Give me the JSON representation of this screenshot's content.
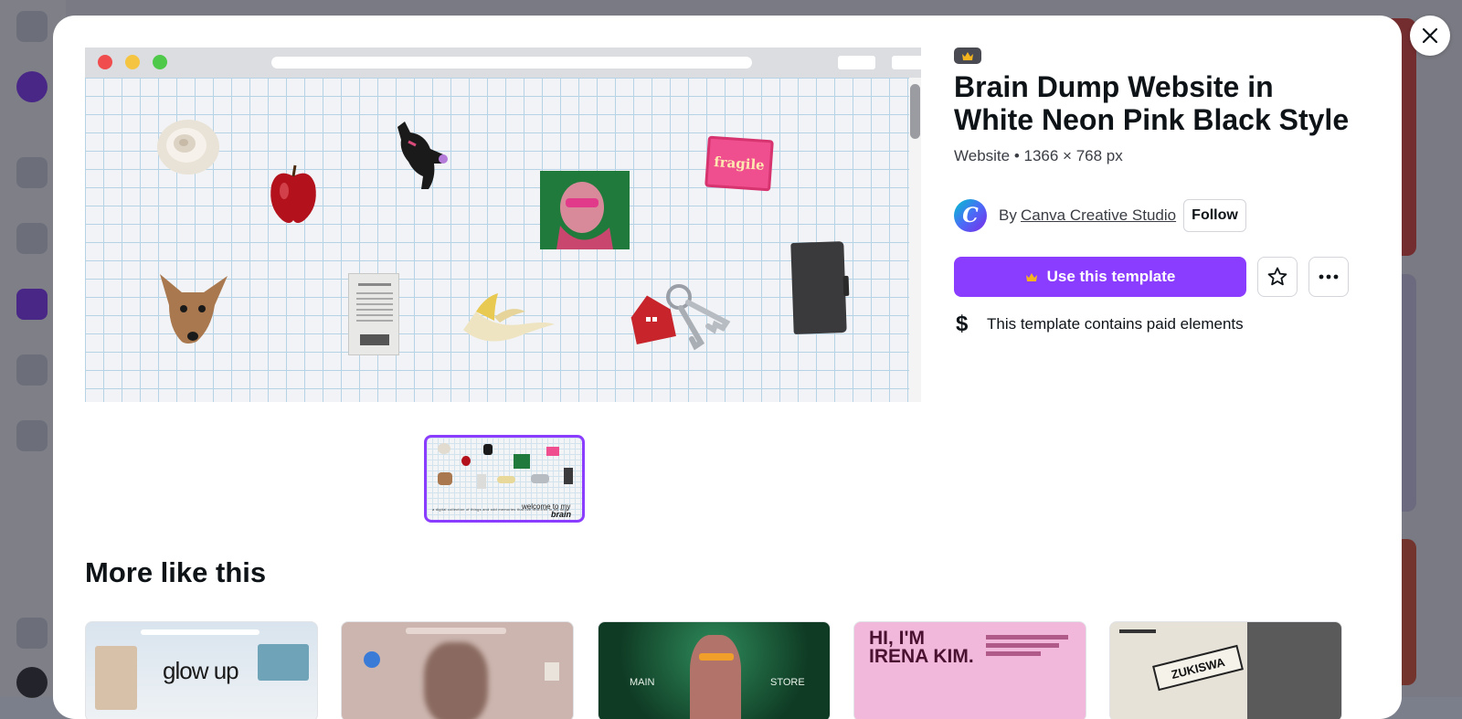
{
  "template": {
    "title": "Brain Dump Website in White Neon Pink Black Style",
    "meta": "Website • 1366 × 768 px",
    "author_prefix": "By",
    "author_name": "Canva Creative Studio",
    "follow_label": "Follow",
    "use_button_label": "Use this template",
    "paid_note": "This template contains paid elements",
    "premium_icon": "crown-icon"
  },
  "preview": {
    "stickers": [
      "fragile"
    ],
    "thumbnail_caption": "a digital collection of things and odd memories that live rent-free in my head",
    "thumbnail_welcome": "welcome to my",
    "thumbnail_brain": "brain"
  },
  "more_like_this": {
    "heading": "More like this",
    "cards": [
      {
        "label": "glow up"
      },
      {
        "label": ""
      },
      {
        "label": "MAIN",
        "label2": "STORE"
      },
      {
        "label": "HI, I'M IRENA KIM."
      },
      {
        "label": "ZUKISWA"
      }
    ]
  },
  "colors": {
    "accent": "#8b3dff",
    "text": "#0e1318"
  }
}
